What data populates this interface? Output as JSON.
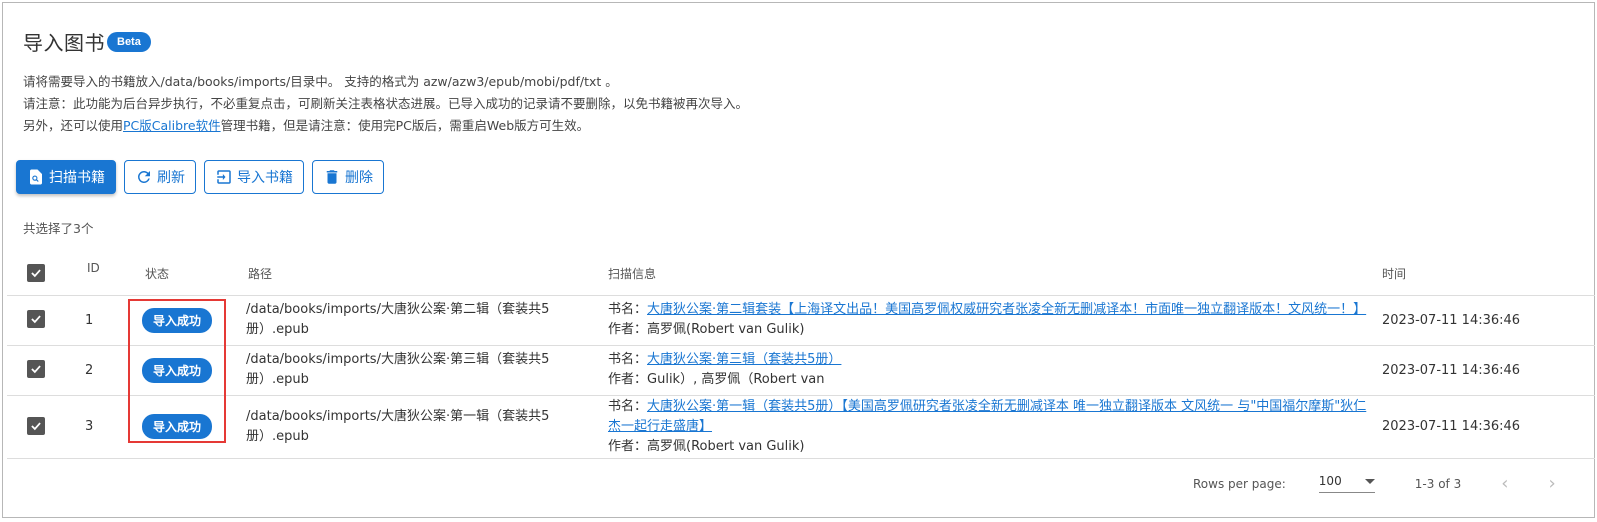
{
  "header": {
    "title": "导入图书",
    "badge": "Beta"
  },
  "notes": {
    "line1": "请将需要导入的书籍放入/data/books/imports/目录中。 支持的格式为 azw/azw3/epub/mobi/pdf/txt 。",
    "line2": "请注意：此功能为后台异步执行，不必重复点击，可刷新关注表格状态进展。已导入成功的记录请不要删除，以免书籍被再次导入。",
    "line3_prefix": "另外，还可以使用",
    "line3_link": "PC版Calibre软件",
    "line3_suffix": "管理书籍，但是请注意：使用完PC版后，需重启Web版方可生效。"
  },
  "toolbar": {
    "scan": "扫描书籍",
    "refresh": "刷新",
    "import": "导入书籍",
    "delete": "删除"
  },
  "selection": {
    "text": "共选择了3个"
  },
  "table": {
    "headers": {
      "id": "ID",
      "status": "状态",
      "path": "路径",
      "scan": "扫描信息",
      "time": "时间"
    },
    "rows": [
      {
        "id": "1",
        "status": "导入成功",
        "path": "/data/books/imports/大唐狄公案·第二辑（套装共5册）.epub",
        "title_label": "书名：",
        "title": "大唐狄公案·第二辑套装【上海译文出品！美国高罗佩权威研究者张凌全新无删减译本！市面唯一独立翻译版本！文风统一！】",
        "author_label": "作者：",
        "author": "高罗佩(Robert van Gulik)",
        "time": "2023-07-11 14:36:46"
      },
      {
        "id": "2",
        "status": "导入成功",
        "path": "/data/books/imports/大唐狄公案·第三辑（套装共5册）.epub",
        "title_label": "书名：",
        "title": "大唐狄公案·第三辑（套装共5册）",
        "author_label": "作者：",
        "author": "Gulik）, 高罗佩（Robert van",
        "time": "2023-07-11 14:36:46"
      },
      {
        "id": "3",
        "status": "导入成功",
        "path": "/data/books/imports/大唐狄公案·第一辑（套装共5册）.epub",
        "title_label": "书名：",
        "title": "大唐狄公案·第一辑（套装共5册）【美国高罗佩研究者张凌全新无删减译本 唯一独立翻译版本 文风统一 与\"中国福尔摩斯\"狄仁杰一起行走盛唐】",
        "author_label": "作者：",
        "author": "高罗佩(Robert van Gulik)",
        "time": "2023-07-11 14:36:46"
      }
    ]
  },
  "pagination": {
    "rows_per_page_label": "Rows per page:",
    "rows_per_page": "100",
    "range": "1-3 of 3"
  },
  "colors": {
    "primary": "#1976d2",
    "highlight": "#e53935"
  }
}
